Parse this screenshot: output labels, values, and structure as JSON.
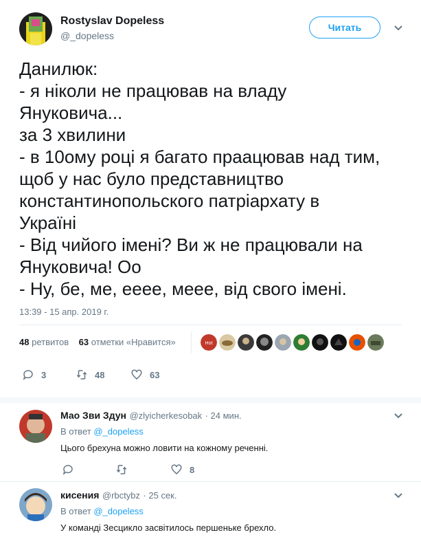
{
  "tweet": {
    "author_name": "Rostyslav Dopeless",
    "author_handle": "@_dopeless",
    "follow_label": "Читать",
    "lines": [
      "Данилюк:",
      "- я ніколи не працював на владу",
      "Януковича...",
      "за 3 хвилини",
      "- в 10ому році я багато праацював над тим,",
      "щоб у нас було представництво",
      "константинопольского патріархату в",
      "Україні",
      "- Від чийого імені? Ви ж не працювали на",
      "Януковича! Оо",
      "- Ну, бе, ме, ееее, мeee, від свого імені."
    ],
    "timestamp": "13:39 - 15 апр. 2019 г.",
    "retweet_count": "48",
    "retweet_label": "ретвитов",
    "like_count": "63",
    "like_label": "отметки «Нравится»",
    "actions": {
      "replies": "3",
      "retweets": "48",
      "likes": "63"
    }
  },
  "replies": [
    {
      "name": "Мао Зви Здун",
      "handle": "@zlyicherkesobak",
      "time": "· 24 мин.",
      "reply_prefix": "В ответ",
      "reply_to": "@_dopeless",
      "text": "Цього брехуна можно ловити на кожному реченні.",
      "actions": {
        "replies": "",
        "retweets": "",
        "likes": "8"
      }
    },
    {
      "name": "кисения",
      "handle": "@rbctybz",
      "time": "· 25 сек.",
      "reply_prefix": "В ответ",
      "reply_to": "@_dopeless",
      "text": "У команді Зесцикло засвітилось першеньке брехло."
    }
  ],
  "colors": {
    "accent": "#1da1f2",
    "muted": "#657786",
    "text": "#14171a",
    "band": "#f5f8fa"
  },
  "icons": [
    "reply-icon",
    "retweet-icon",
    "like-icon",
    "chevron-down-icon"
  ]
}
